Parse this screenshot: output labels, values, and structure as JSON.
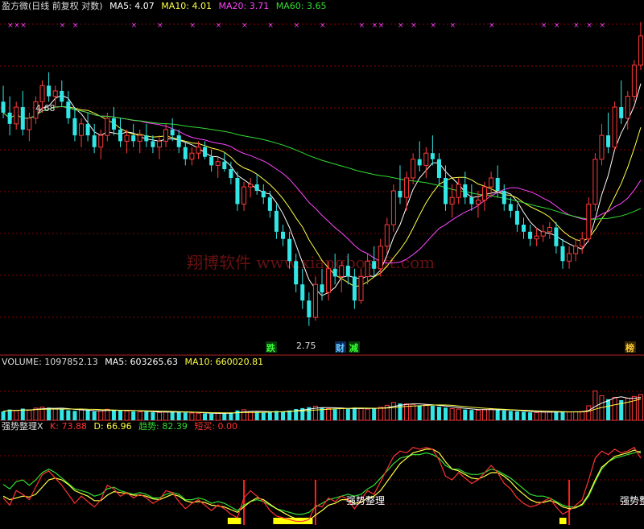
{
  "price_header": {
    "title": "盈方微(日线 前复权 对数)",
    "ma5": "MA5: 4.07",
    "ma10": "MA10: 4.01",
    "ma20": "MA20: 3.71",
    "ma60": "MA60: 3.65"
  },
  "volume_header": {
    "title": "VOLUME: 1097852.13",
    "ma5": "MA5: 603265.63",
    "ma10": "MA10: 660020.81"
  },
  "indicator_header": {
    "title": "强势整理X",
    "k": "K: 73.88",
    "d": "D: 66.96",
    "trend": "趋势: 82.39",
    "short_buy": "短买: 0.00"
  },
  "watermark": "翔博软件 www.xiangbosoft.com",
  "annotations": {
    "high_label": "4.68",
    "low_label": "2.75",
    "signal_1": "跌",
    "signal_2": "财",
    "signal_3": "减",
    "signal_4": "榜",
    "indicator_text_1": "强势整理",
    "indicator_text_2": "强势整"
  },
  "colors": {
    "up": "#ff3a3a",
    "down": "#33e6e6",
    "ma5": "#ffffff",
    "ma10": "#ffff44",
    "ma20": "#ff44ff",
    "ma60": "#33dd33",
    "k": "#ff3333",
    "d": "#ffff44",
    "trend": "#33dd33",
    "marker": "#ff44ff"
  },
  "chart_data": {
    "type": "candlestick",
    "scale": "log",
    "price_range": [
      2.6,
      5.3
    ],
    "ohlc": [
      [
        4.4,
        4.55,
        4.25,
        4.3
      ],
      [
        4.3,
        4.45,
        4.1,
        4.2
      ],
      [
        4.2,
        4.4,
        4.15,
        4.35
      ],
      [
        4.35,
        4.5,
        4.1,
        4.15
      ],
      [
        4.15,
        4.3,
        4.05,
        4.25
      ],
      [
        4.25,
        4.45,
        4.2,
        4.4
      ],
      [
        4.4,
        4.6,
        4.3,
        4.55
      ],
      [
        4.55,
        4.68,
        4.4,
        4.45
      ],
      [
        4.45,
        4.55,
        4.35,
        4.5
      ],
      [
        4.5,
        4.6,
        4.35,
        4.4
      ],
      [
        4.4,
        4.5,
        4.2,
        4.25
      ],
      [
        4.25,
        4.35,
        4.05,
        4.1
      ],
      [
        4.1,
        4.25,
        4.0,
        4.2
      ],
      [
        4.2,
        4.3,
        4.05,
        4.1
      ],
      [
        4.1,
        4.2,
        3.95,
        4.0
      ],
      [
        4.0,
        4.15,
        3.9,
        4.1
      ],
      [
        4.1,
        4.3,
        4.05,
        4.25
      ],
      [
        4.25,
        4.35,
        4.1,
        4.15
      ],
      [
        4.15,
        4.25,
        4.0,
        4.05
      ],
      [
        4.05,
        4.15,
        3.95,
        4.1
      ],
      [
        4.1,
        4.2,
        4.0,
        4.05
      ],
      [
        4.05,
        4.15,
        3.95,
        4.1
      ],
      [
        4.1,
        4.2,
        4.0,
        4.05
      ],
      [
        4.05,
        4.1,
        3.95,
        4.0
      ],
      [
        4.0,
        4.1,
        3.9,
        4.05
      ],
      [
        4.05,
        4.2,
        4.0,
        4.15
      ],
      [
        4.15,
        4.25,
        4.05,
        4.1
      ],
      [
        4.1,
        4.15,
        3.95,
        4.0
      ],
      [
        4.0,
        4.05,
        3.85,
        3.9
      ],
      [
        3.9,
        4.0,
        3.85,
        3.95
      ],
      [
        3.95,
        4.05,
        3.9,
        4.0
      ],
      [
        4.0,
        4.05,
        3.9,
        3.92
      ],
      [
        3.92,
        3.98,
        3.8,
        3.85
      ],
      [
        3.85,
        3.92,
        3.75,
        3.88
      ],
      [
        3.88,
        3.95,
        3.8,
        3.82
      ],
      [
        3.82,
        3.88,
        3.7,
        3.75
      ],
      [
        3.75,
        3.8,
        3.5,
        3.55
      ],
      [
        3.55,
        3.72,
        3.5,
        3.68
      ],
      [
        3.68,
        3.75,
        3.6,
        3.7
      ],
      [
        3.7,
        3.78,
        3.62,
        3.65
      ],
      [
        3.65,
        3.7,
        3.55,
        3.6
      ],
      [
        3.6,
        3.65,
        3.45,
        3.5
      ],
      [
        3.5,
        3.55,
        3.3,
        3.35
      ],
      [
        3.35,
        3.4,
        3.25,
        3.3
      ],
      [
        3.3,
        3.35,
        3.1,
        3.15
      ],
      [
        3.15,
        3.2,
        2.95,
        3.0
      ],
      [
        3.0,
        3.1,
        2.85,
        2.9
      ],
      [
        2.9,
        2.95,
        2.75,
        2.8
      ],
      [
        2.8,
        3.05,
        2.78,
        3.0
      ],
      [
        3.0,
        3.1,
        2.9,
        2.95
      ],
      [
        2.95,
        3.15,
        2.9,
        3.1
      ],
      [
        3.1,
        3.2,
        3.0,
        3.05
      ],
      [
        3.05,
        3.15,
        2.95,
        3.12
      ],
      [
        3.12,
        3.2,
        3.0,
        3.05
      ],
      [
        3.05,
        3.1,
        2.85,
        2.9
      ],
      [
        2.9,
        3.1,
        2.88,
        3.05
      ],
      [
        3.05,
        3.2,
        3.0,
        3.15
      ],
      [
        3.15,
        3.25,
        3.05,
        3.1
      ],
      [
        3.1,
        3.3,
        3.05,
        3.25
      ],
      [
        3.25,
        3.45,
        3.2,
        3.4
      ],
      [
        3.4,
        3.7,
        3.35,
        3.65
      ],
      [
        3.65,
        3.85,
        3.55,
        3.6
      ],
      [
        3.6,
        3.8,
        3.5,
        3.75
      ],
      [
        3.75,
        3.95,
        3.7,
        3.9
      ],
      [
        3.9,
        4.05,
        3.8,
        3.85
      ],
      [
        3.85,
        4.0,
        3.75,
        3.95
      ],
      [
        3.95,
        4.1,
        3.85,
        3.9
      ],
      [
        3.9,
        3.95,
        3.7,
        3.75
      ],
      [
        3.75,
        3.85,
        3.5,
        3.55
      ],
      [
        3.55,
        3.7,
        3.45,
        3.6
      ],
      [
        3.6,
        3.75,
        3.55,
        3.7
      ],
      [
        3.7,
        3.8,
        3.55,
        3.6
      ],
      [
        3.6,
        3.7,
        3.5,
        3.55
      ],
      [
        3.55,
        3.65,
        3.45,
        3.58
      ],
      [
        3.58,
        3.72,
        3.5,
        3.68
      ],
      [
        3.68,
        3.8,
        3.6,
        3.75
      ],
      [
        3.75,
        3.85,
        3.6,
        3.65
      ],
      [
        3.65,
        3.7,
        3.5,
        3.55
      ],
      [
        3.55,
        3.6,
        3.45,
        3.5
      ],
      [
        3.5,
        3.55,
        3.35,
        3.4
      ],
      [
        3.4,
        3.45,
        3.3,
        3.35
      ],
      [
        3.35,
        3.4,
        3.25,
        3.3
      ],
      [
        3.3,
        3.38,
        3.25,
        3.32
      ],
      [
        3.32,
        3.4,
        3.28,
        3.35
      ],
      [
        3.35,
        3.42,
        3.3,
        3.38
      ],
      [
        3.38,
        3.42,
        3.2,
        3.25
      ],
      [
        3.25,
        3.3,
        3.1,
        3.15
      ],
      [
        3.15,
        3.25,
        3.1,
        3.2
      ],
      [
        3.2,
        3.3,
        3.15,
        3.25
      ],
      [
        3.25,
        3.35,
        3.2,
        3.3
      ],
      [
        3.3,
        3.6,
        3.28,
        3.55
      ],
      [
        3.55,
        3.95,
        3.5,
        3.9
      ],
      [
        3.9,
        4.2,
        3.85,
        4.1
      ],
      [
        4.1,
        4.3,
        3.95,
        4.0
      ],
      [
        4.0,
        4.4,
        3.98,
        4.35
      ],
      [
        4.35,
        4.6,
        4.2,
        4.25
      ],
      [
        4.25,
        4.5,
        4.15,
        4.45
      ],
      [
        4.45,
        4.8,
        4.4,
        4.75
      ],
      [
        4.75,
        5.2,
        4.7,
        5.05
      ]
    ],
    "ma_params": [
      5,
      10,
      20,
      60
    ],
    "volume_scale": [
      0,
      2200000
    ],
    "volume": [
      380000,
      460000,
      420000,
      500000,
      440000,
      520000,
      560000,
      540000,
      500000,
      470000,
      430000,
      400000,
      440000,
      420000,
      380000,
      410000,
      470000,
      450000,
      420000,
      400000,
      380000,
      360000,
      370000,
      340000,
      330000,
      350000,
      380000,
      360000,
      330000,
      310000,
      300000,
      290000,
      280000,
      300000,
      310000,
      330000,
      420000,
      450000,
      380000,
      340000,
      320000,
      360000,
      400000,
      380000,
      420000,
      480000,
      520000,
      560000,
      600000,
      540000,
      500000,
      470000,
      520000,
      480000,
      540000,
      500000,
      480000,
      520000,
      560000,
      640000,
      760000,
      720000,
      700000,
      680000,
      640000,
      660000,
      620000,
      580000,
      540000,
      500000,
      480000,
      460000,
      440000,
      430000,
      460000,
      480000,
      450000,
      420000,
      400000,
      380000,
      360000,
      340000,
      330000,
      350000,
      360000,
      380000,
      370000,
      350000,
      360000,
      380000,
      620000,
      1250000,
      1050000,
      900000,
      980000,
      860000,
      940000,
      1020000,
      1097852
    ],
    "indicator_range": [
      0,
      100
    ],
    "k": [
      30,
      22,
      38,
      34,
      28,
      42,
      56,
      60,
      52,
      44,
      34,
      24,
      32,
      26,
      20,
      28,
      44,
      40,
      32,
      36,
      30,
      34,
      30,
      24,
      28,
      38,
      36,
      26,
      18,
      24,
      28,
      22,
      16,
      22,
      18,
      12,
      8,
      30,
      38,
      32,
      26,
      16,
      10,
      8,
      6,
      4,
      4,
      6,
      22,
      20,
      30,
      26,
      32,
      28,
      18,
      28,
      38,
      34,
      48,
      62,
      76,
      82,
      80,
      86,
      84,
      86,
      84,
      72,
      54,
      50,
      58,
      52,
      46,
      50,
      58,
      66,
      58,
      46,
      40,
      30,
      24,
      20,
      22,
      26,
      30,
      20,
      12,
      16,
      22,
      28,
      50,
      74,
      82,
      78,
      84,
      80,
      82,
      86,
      74
    ],
    "d": [
      32,
      28,
      30,
      32,
      31,
      34,
      42,
      50,
      52,
      50,
      45,
      38,
      35,
      32,
      27,
      27,
      33,
      37,
      36,
      35,
      33,
      33,
      32,
      29,
      28,
      31,
      34,
      32,
      27,
      25,
      26,
      25,
      22,
      21,
      20,
      17,
      14,
      20,
      26,
      30,
      28,
      23,
      18,
      14,
      10,
      7,
      5,
      5,
      11,
      16,
      22,
      24,
      28,
      28,
      24,
      25,
      30,
      32,
      38,
      48,
      58,
      68,
      74,
      80,
      82,
      84,
      84,
      80,
      70,
      62,
      60,
      56,
      52,
      51,
      54,
      58,
      58,
      54,
      48,
      40,
      34,
      28,
      25,
      25,
      27,
      25,
      20,
      18,
      19,
      23,
      34,
      50,
      64,
      70,
      76,
      78,
      80,
      83,
      80
    ],
    "trend": [
      45,
      40,
      48,
      50,
      44,
      50,
      58,
      62,
      58,
      52,
      46,
      40,
      38,
      36,
      32,
      34,
      40,
      42,
      38,
      36,
      34,
      36,
      34,
      30,
      30,
      34,
      36,
      34,
      28,
      28,
      30,
      28,
      24,
      26,
      24,
      20,
      16,
      22,
      26,
      28,
      26,
      22,
      18,
      16,
      14,
      12,
      12,
      14,
      20,
      24,
      28,
      30,
      32,
      34,
      32,
      34,
      40,
      44,
      52,
      60,
      68,
      74,
      76,
      78,
      78,
      80,
      78,
      74,
      66,
      62,
      62,
      58,
      56,
      56,
      58,
      62,
      60,
      56,
      52,
      46,
      40,
      34,
      32,
      32,
      30,
      26,
      22,
      20,
      20,
      22,
      32,
      48,
      62,
      70,
      74,
      76,
      78,
      80,
      82
    ]
  }
}
